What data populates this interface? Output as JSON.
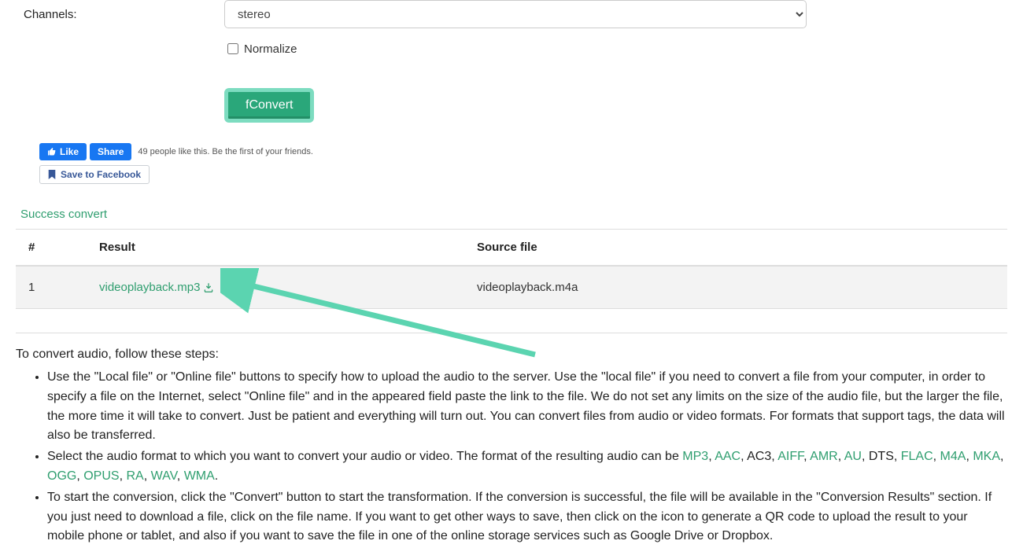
{
  "form": {
    "channels_label": "Channels:",
    "channels_value": "stereo",
    "normalize_label": "Normalize",
    "convert_label": "fConvert"
  },
  "facebook": {
    "like": "Like",
    "share": "Share",
    "sub": "49 people like this. Be the first of your friends.",
    "save": "Save to Facebook"
  },
  "results": {
    "title": "Success convert",
    "headers": {
      "num": "#",
      "result": "Result",
      "source": "Source file"
    },
    "rows": [
      {
        "num": "1",
        "result": "videoplayback.mp3",
        "source": "videoplayback.m4a"
      }
    ]
  },
  "steps": {
    "intro": "To convert audio, follow these steps:",
    "item1": "Use the \"Local file\" or \"Online file\" buttons to specify how to upload the audio to the server. Use the \"local file\" if you need to convert a file from your computer, in order to specify a file on the Internet, select \"Online file\" and in the appeared field paste the link to the file. We do not set any limits on the size of the audio file, but the larger the file, the more time it will take to convert. Just be patient and everything will turn out. You can convert files from audio or video formats. For formats that support tags, the data will also be transferred.",
    "item2_pre": "Select the audio format to which you want to convert your audio or video. The format of the resulting audio can be ",
    "fmt": {
      "mp3": "MP3",
      "aac": "AAC",
      "ac3": ", AC3, ",
      "aiff": "AIFF",
      "amr": "AMR",
      "au": "AU",
      "dts": ", DTS, ",
      "flac": "FLAC",
      "m4a": "M4A",
      "mka": "MKA",
      "ogg": "OGG",
      "opus": "OPUS",
      "ra": "RA",
      "wav": "WAV",
      "wma": "WMA"
    },
    "sep": ", ",
    "dot": ".",
    "item3": "To start the conversion, click the \"Convert\" button to start the transformation. If the conversion is successful, the file will be available in the \"Conversion Results\" section. If you just need to download a file, click on the file name. If you want to get other ways to save, then click on the icon to generate a QR code to upload the result to your mobile phone or tablet, and also if you want to save the file in one of the online storage services such as Google Drive or Dropbox."
  }
}
